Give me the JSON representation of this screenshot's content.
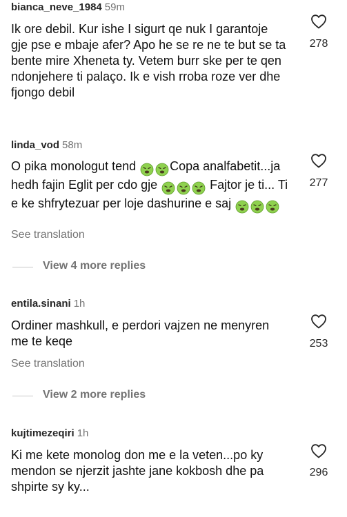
{
  "comments": [
    {
      "username": "bianca_neve_1984",
      "time": "59m",
      "text": "Ik ore debil. Kur ishe I sigurt qe nuk I garantoje gje pse e mbaje afer? Apo he se re ne te but se ta bente mire Xheneta ty. Vetem burr ske per te qen ndonjehere ti palaço. Ik e vish rroba roze ver dhe fjongo debil",
      "likes": "278"
    },
    {
      "username": "linda_vod",
      "time": "58m",
      "text_parts": [
        "O pika monologut tend ",
        "Copa analfabetit...ja hedh fajin Eglit per cdo gje ",
        " Fajtor je ti... Ti e ke shfrytezuar per loje dashurine e saj "
      ],
      "emoji": "nauseated-face-emoji",
      "likes": "277",
      "see_translation": "See translation",
      "view_replies": "View 4 more replies"
    },
    {
      "username": "entila.sinani",
      "time": "1h",
      "text": "Ordiner mashkull, e perdori vajzen ne menyren me te keqe",
      "likes": "253",
      "see_translation": "See translation",
      "view_replies": "View 2 more replies"
    },
    {
      "username": "kujtimezeqiri",
      "time": "1h",
      "text": "Ki me kete monolog don me e la veten...po ky mendon se njerzit  jashte jane kokbosh dhe pa shpirte sy ky...",
      "likes": "296"
    }
  ],
  "colors": {
    "text": "#111111",
    "muted": "#737373",
    "emoji_face": "#8fd14f"
  }
}
